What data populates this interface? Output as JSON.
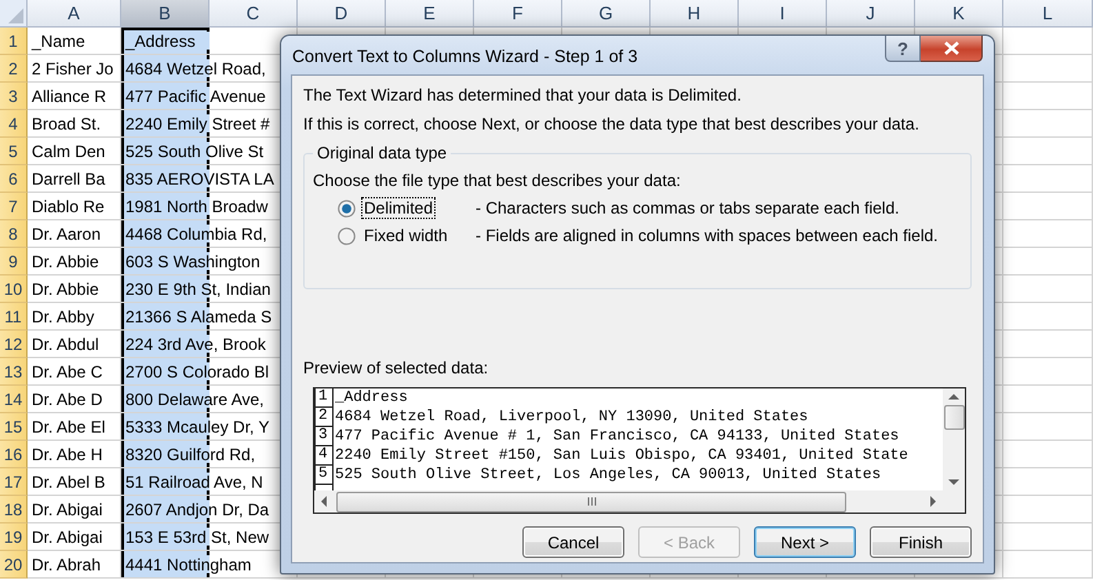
{
  "sheet": {
    "columns": [
      {
        "label": "A",
        "selected": false
      },
      {
        "label": "B",
        "selected": true
      },
      {
        "label": "C",
        "selected": false
      },
      {
        "label": "D",
        "selected": false
      },
      {
        "label": "E",
        "selected": false
      },
      {
        "label": "F",
        "selected": false
      },
      {
        "label": "G",
        "selected": false
      },
      {
        "label": "H",
        "selected": false
      },
      {
        "label": "I",
        "selected": false
      },
      {
        "label": "J",
        "selected": false
      },
      {
        "label": "K",
        "selected": false
      },
      {
        "label": "L",
        "selected": false
      }
    ],
    "rows": [
      {
        "number": "1",
        "cells": [
          "_Name",
          "_Address"
        ]
      },
      {
        "number": "2",
        "cells": [
          "2 Fisher Jo",
          "4684 Wetzel Road,"
        ]
      },
      {
        "number": "3",
        "cells": [
          "Alliance R",
          "477 Pacific Avenue"
        ]
      },
      {
        "number": "4",
        "cells": [
          "Broad St.",
          "2240 Emily Street #"
        ]
      },
      {
        "number": "5",
        "cells": [
          "Calm Den",
          "525 South Olive St"
        ]
      },
      {
        "number": "6",
        "cells": [
          "Darrell Ba",
          "835 AEROVISTA LA"
        ]
      },
      {
        "number": "7",
        "cells": [
          "Diablo Re",
          "1981 North Broadw"
        ]
      },
      {
        "number": "8",
        "cells": [
          "Dr. Aaron",
          "4468 Columbia Rd,"
        ]
      },
      {
        "number": "9",
        "cells": [
          "Dr. Abbie",
          "603 S Washington"
        ]
      },
      {
        "number": "10",
        "cells": [
          "Dr. Abbie",
          "230 E 9th St, Indian"
        ]
      },
      {
        "number": "11",
        "cells": [
          "Dr. Abby",
          "21366 S Alameda S"
        ]
      },
      {
        "number": "12",
        "cells": [
          "Dr. Abdul",
          "224 3rd Ave, Brook"
        ]
      },
      {
        "number": "13",
        "cells": [
          "Dr. Abe C",
          "2700 S Colorado Bl"
        ]
      },
      {
        "number": "14",
        "cells": [
          "Dr. Abe D",
          "800 Delaware Ave,"
        ]
      },
      {
        "number": "15",
        "cells": [
          "Dr. Abe El",
          "5333 Mcauley Dr, Y"
        ]
      },
      {
        "number": "16",
        "cells": [
          "Dr. Abe H",
          "8320 Guilford Rd,"
        ]
      },
      {
        "number": "17",
        "cells": [
          "Dr. Abel B",
          "51 Railroad Ave, N"
        ]
      },
      {
        "number": "18",
        "cells": [
          "Dr. Abigai",
          "2607 Andjon Dr, Da"
        ]
      },
      {
        "number": "19",
        "cells": [
          "Dr. Abigai",
          "153 E 53rd St, New"
        ]
      },
      {
        "number": "20",
        "cells": [
          "Dr. Abrah",
          "4441 Nottingham"
        ]
      }
    ]
  },
  "dialog": {
    "title": "Convert Text to Columns Wizard - Step 1 of 3",
    "help_button": "?",
    "intro": "The Text Wizard has determined that your data is Delimited.",
    "instruction": "If this is correct, choose Next, or choose the data type that best describes your data.",
    "group": {
      "legend": "Original data type",
      "prompt": "Choose the file type that best describes your data:",
      "options": [
        {
          "label": "Delimited",
          "description": "- Characters such as commas or tabs separate each field.",
          "selected": true,
          "focused": true
        },
        {
          "label": "Fixed width",
          "description": "- Fields are aligned in columns with spaces between each field.",
          "selected": false,
          "focused": false
        }
      ]
    },
    "preview": {
      "label": "Preview of selected data:",
      "lines": [
        {
          "number": "1",
          "text": "_Address"
        },
        {
          "number": "2",
          "text": "4684 Wetzel Road, Liverpool, NY 13090, United States"
        },
        {
          "number": "3",
          "text": "477 Pacific Avenue # 1, San Francisco, CA 94133, United States"
        },
        {
          "number": "4",
          "text": "2240 Emily Street #150, San Luis Obispo, CA 93401, United State"
        },
        {
          "number": "5",
          "text": "525 South Olive Street, Los Angeles, CA 90013, United States"
        }
      ]
    },
    "buttons": [
      {
        "label": "Cancel",
        "disabled": false,
        "default": false
      },
      {
        "label": "< Back",
        "disabled": true,
        "default": false
      },
      {
        "label": "Next >",
        "disabled": false,
        "default": true
      },
      {
        "label": "Finish",
        "disabled": false,
        "default": false
      }
    ]
  }
}
